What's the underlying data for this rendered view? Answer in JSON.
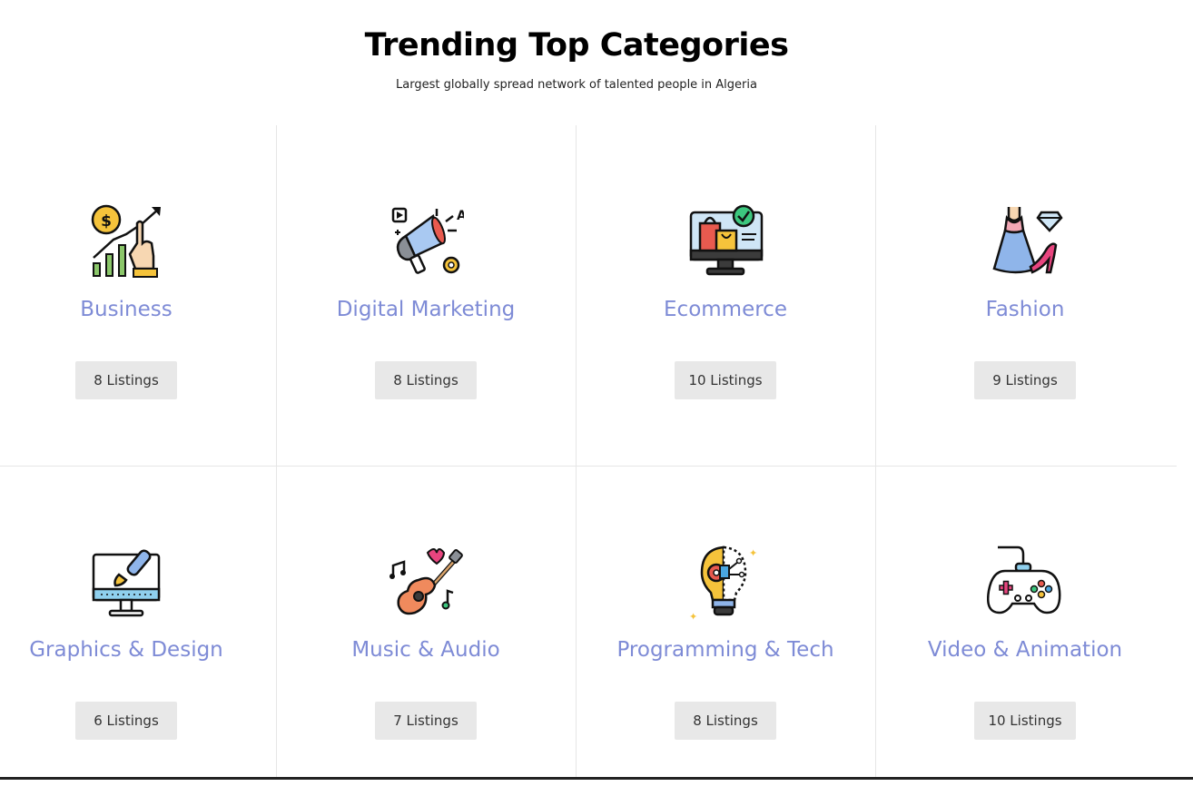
{
  "header": {
    "title": "Trending Top Categories",
    "subtitle": "Largest globally spread network of talented people in Algeria"
  },
  "categories": [
    {
      "name": "Business",
      "listings": "8 Listings",
      "icon": "business-growth-icon"
    },
    {
      "name": "Digital Marketing",
      "listings": "8 Listings",
      "icon": "megaphone-icon"
    },
    {
      "name": "Ecommerce",
      "listings": "10 Listings",
      "icon": "ecommerce-monitor-icon"
    },
    {
      "name": "Fashion",
      "listings": "9 Listings",
      "icon": "fashion-dress-icon"
    },
    {
      "name": "Graphics & Design",
      "listings": "6 Listings",
      "icon": "design-monitor-brush-icon"
    },
    {
      "name": "Music & Audio",
      "listings": "7 Listings",
      "icon": "guitar-icon"
    },
    {
      "name": "Programming & Tech",
      "listings": "8 Listings",
      "icon": "tech-bulb-icon"
    },
    {
      "name": "Video & Animation",
      "listings": "10 Listings",
      "icon": "gamepad-icon"
    }
  ],
  "colors": {
    "category_name": "#7e8bd6",
    "badge_bg": "#e8e8e8",
    "divider": "#e6e6e6"
  }
}
